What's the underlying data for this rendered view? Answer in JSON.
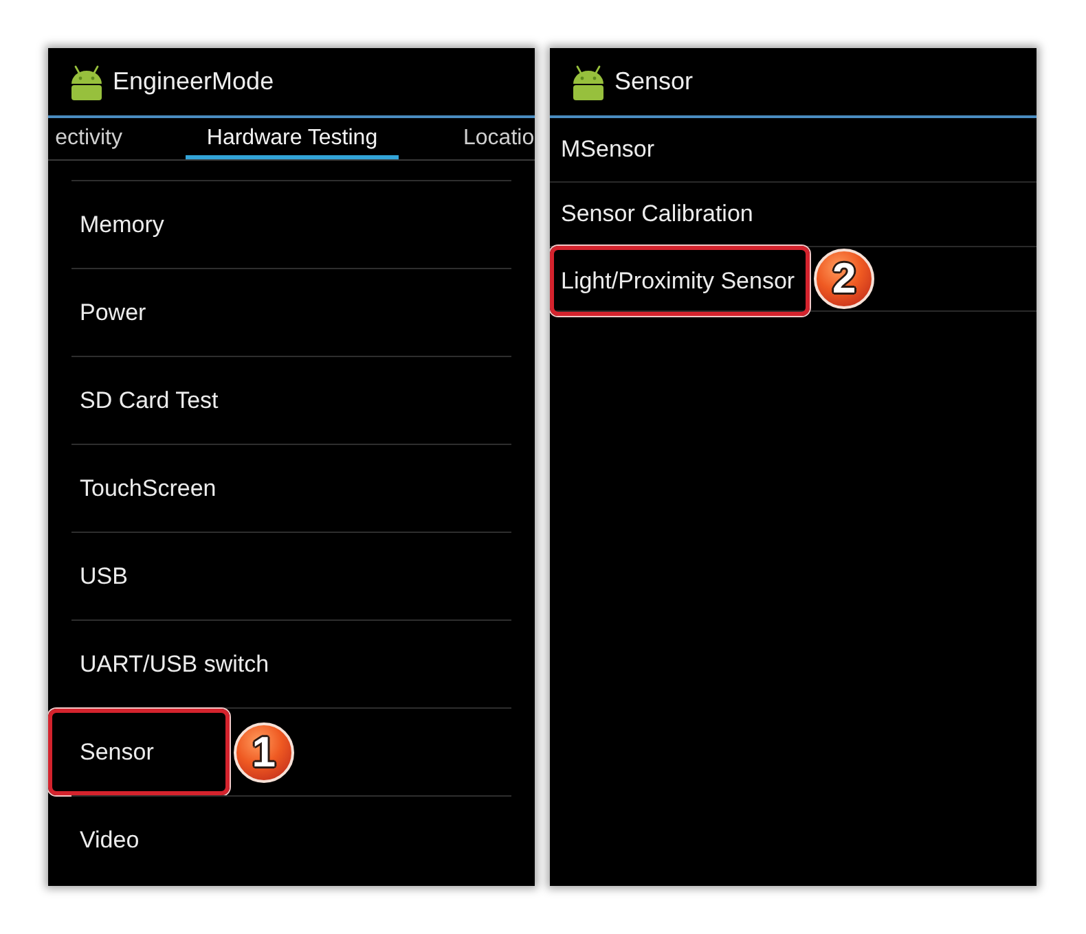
{
  "panels": [
    {
      "kind": "tabbed",
      "title": "EngineerMode",
      "tabs": [
        {
          "label": "ectivity",
          "selected": false
        },
        {
          "label": "Hardware Testing",
          "selected": true
        },
        {
          "label": "Locatio",
          "selected": false
        }
      ],
      "items": [
        {
          "label": "Memory",
          "highlighted": false
        },
        {
          "label": "Power",
          "highlighted": false
        },
        {
          "label": "SD Card Test",
          "highlighted": false
        },
        {
          "label": "TouchScreen",
          "highlighted": false
        },
        {
          "label": "USB",
          "highlighted": false
        },
        {
          "label": "UART/USB switch",
          "highlighted": false
        },
        {
          "label": "Sensor",
          "highlighted": true,
          "step": "1"
        },
        {
          "label": "Video",
          "highlighted": false
        }
      ]
    },
    {
      "kind": "plain",
      "title": "Sensor",
      "items": [
        {
          "label": "MSensor",
          "highlighted": false
        },
        {
          "label": "Sensor Calibration",
          "highlighted": false
        },
        {
          "label": "Light/Proximity Sensor",
          "highlighted": true,
          "step": "2"
        }
      ]
    }
  ]
}
